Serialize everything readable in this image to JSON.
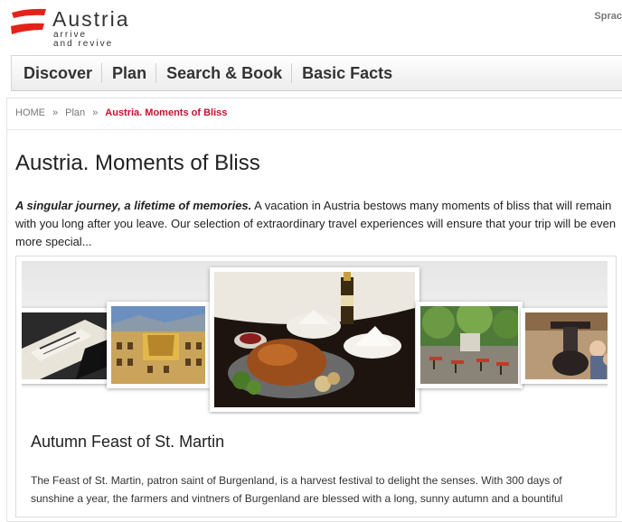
{
  "header": {
    "brand": "Austria",
    "tagline_1": "arrive",
    "tagline_2": "and revive",
    "language_link": "Sprac"
  },
  "nav": {
    "items": [
      {
        "label": "Discover"
      },
      {
        "label": "Plan"
      },
      {
        "label": "Search & Book"
      },
      {
        "label": "Basic Facts"
      }
    ]
  },
  "breadcrumb": {
    "home": "HOME",
    "separator": "»",
    "plan": "Plan",
    "current": "Austria. Moments of Bliss"
  },
  "page": {
    "title": "Austria. Moments of Bliss",
    "intro_emphasis": "A singular journey, a lifetime of memories.",
    "intro_text": " A vacation in Austria bestows many moments of bliss that will remain with you long after you leave. Our selection of extraordinary travel experiences will ensure that your trip will be even more special..."
  },
  "feature": {
    "title": "Autumn Feast of St. Martin",
    "text": "The Feast of St. Martin, patron saint of Burgenland, is a harvest festival to delight the senses. With 300 days of sunshine a year, the farmers and vintners of Burgenland are blessed with a long, sunny autumn and a bountiful"
  },
  "carousel": {
    "images": [
      {
        "icon": "wine-bottle-photo"
      },
      {
        "icon": "golden-roof-photo"
      },
      {
        "icon": "roast-goose-feast-photo"
      },
      {
        "icon": "garden-restaurant-photo"
      },
      {
        "icon": "wine-press-photo"
      }
    ]
  },
  "colors": {
    "brand_red": "#e2231a",
    "breadcrumb_active": "#c8102e"
  }
}
